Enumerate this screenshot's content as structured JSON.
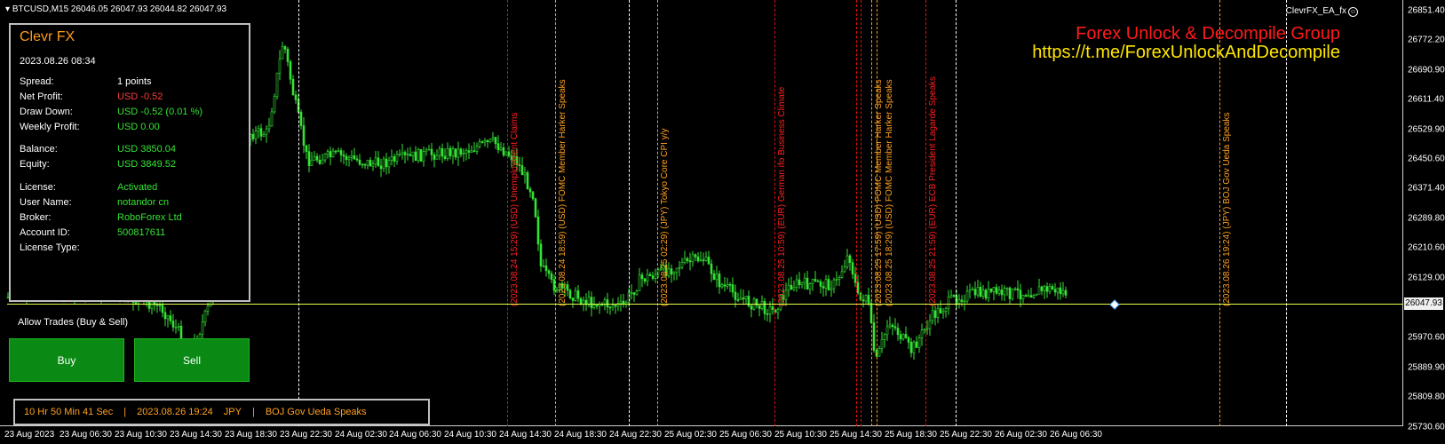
{
  "header": {
    "symbol_info": "BTCUSD,M15  26046.05 26047.93 26044.82 26047.93",
    "ea_name": "ClevrFX_EA_fx"
  },
  "watermark": {
    "line1": "Forex Unlock & Decompile Group",
    "line2": "https://t.me/ForexUnlockAndDecompile"
  },
  "price_scale": [
    "26851.40",
    "26772.20",
    "26690.90",
    "26611.40",
    "26529.90",
    "26450.60",
    "26371.40",
    "26289.80",
    "26210.60",
    "26129.00",
    "25970.60",
    "25889.90",
    "25809.80",
    "25730.60"
  ],
  "current_price": "26047.93",
  "time_scale": [
    "23 Aug 2023",
    "23 Aug 06:30",
    "23 Aug 10:30",
    "23 Aug 14:30",
    "23 Aug 18:30",
    "23 Aug 22:30",
    "24 Aug 02:30",
    "24 Aug 06:30",
    "24 Aug 10:30",
    "24 Aug 14:30",
    "24 Aug 18:30",
    "24 Aug 22:30",
    "25 Aug 02:30",
    "25 Aug 06:30",
    "25 Aug 10:30",
    "25 Aug 14:30",
    "25 Aug 18:30",
    "25 Aug 22:30",
    "26 Aug 02:30",
    "26 Aug 06:30"
  ],
  "news_events": [
    {
      "text": "(2023.08.24 15:29) (USD) Unemployment Claims",
      "color": "red"
    },
    {
      "text": "(2023.08.24 18:59) (USD) FOMC Member Harker Speaks",
      "color": "orange"
    },
    {
      "text": "(2023.08.25 02:29) (JPY) Tokyo Core CPI y/y",
      "color": "orange"
    },
    {
      "text": "(2023.08.25 10:59) (EUR) German ifo Business Climate",
      "color": "red"
    },
    {
      "text": "(2023.08.25 17:59) (USD) FOMC Member Harker Speaks",
      "color": "orange"
    },
    {
      "text": "(2023.08.25 18:29) (USD) FOMC Member Harker Speaks",
      "color": "orange"
    },
    {
      "text": "(2023.08.25 21:59) (EUR) ECB President Lagarde Speaks",
      "color": "red"
    },
    {
      "text": "(2023.08.26 19:24) (JPY) BOJ Gov Ueda Speaks",
      "color": "orange"
    }
  ],
  "panel": {
    "title": "Clevr FX",
    "datetime": "2023.08.26 08:34",
    "spread_label": "Spread:",
    "spread_value": "1 points",
    "net_profit_label": "Net Profit:",
    "net_profit_value": "USD -0.52",
    "draw_down_label": "Draw Down:",
    "draw_down_value": "USD -0.52 (0.01 %)",
    "weekly_profit_label": "Weekly Profit:",
    "weekly_profit_value": "USD 0.00",
    "balance_label": "Balance:",
    "balance_value": "USD 3850.04",
    "equity_label": "Equity:",
    "equity_value": "USD 3849.52",
    "license_label": "License:",
    "license_value": "Activated",
    "user_label": "User Name:",
    "user_value": "notandor cn",
    "broker_label": "Broker:",
    "broker_value": "RoboForex Ltd",
    "account_label": "Account ID:",
    "account_value": "500817611",
    "license_type_label": "License Type:",
    "license_type_value": ""
  },
  "trading": {
    "allow_trades": "Allow Trades (Buy & Sell)",
    "buy_label": "Buy",
    "sell_label": "Sell"
  },
  "news_bar": {
    "countdown": "10 Hr 50 Min 41 Sec",
    "sep": "|",
    "datetime": "2023.08.26 19:24",
    "currency": "JPY",
    "event": "BOJ Gov Ueda Speaks"
  },
  "colors": {
    "candle": "#34e334",
    "current_line": "#e7ff4a",
    "panel_border": "#bfbfbf",
    "button_green": "#0a8a14"
  }
}
